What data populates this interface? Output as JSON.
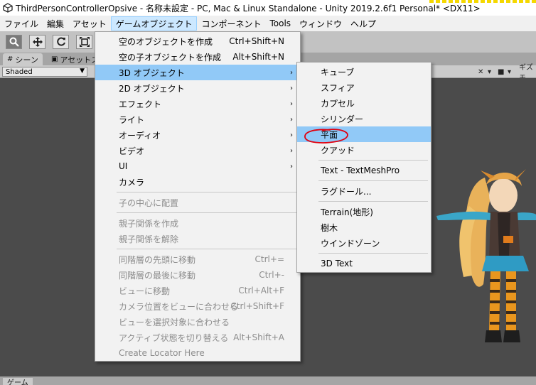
{
  "window": {
    "title": "ThirdPersonControllerOpsive - 名称未設定 - PC, Mac & Linux Standalone - Unity 2019.2.6f1 Personal* <DX11>"
  },
  "menubar": {
    "items": [
      "ファイル",
      "編集",
      "アセット",
      "ゲームオブジェクト",
      "コンポーネント",
      "Tools",
      "ウィンドウ",
      "ヘルプ"
    ]
  },
  "toolbar": {
    "tools": [
      "view-tool",
      "move-tool",
      "rotate-tool",
      "scale-tool"
    ]
  },
  "tabs": {
    "scene": "シーン",
    "asset_store": "アセットスト",
    "game": "ゲーム"
  },
  "scene_toolbar": {
    "shading_mode": "Shaded",
    "gizmos_label": "ギズモ"
  },
  "gameobject_menu": {
    "items": [
      {
        "label": "空のオブジェクトを作成",
        "shortcut": "Ctrl+Shift+N"
      },
      {
        "label": "空の子オブジェクトを作成",
        "shortcut": "Alt+Shift+N"
      },
      {
        "label": "3D オブジェクト",
        "submenu": true
      },
      {
        "label": "2D オブジェクト",
        "submenu": true
      },
      {
        "label": "エフェクト",
        "submenu": true
      },
      {
        "label": "ライト",
        "submenu": true
      },
      {
        "label": "オーディオ",
        "submenu": true
      },
      {
        "label": "ビデオ",
        "submenu": true
      },
      {
        "label": "UI",
        "submenu": true
      },
      {
        "label": "カメラ"
      },
      {
        "label": "子の中心に配置"
      },
      {
        "label": "親子関係を作成"
      },
      {
        "label": "親子関係を解除"
      },
      {
        "label": "同階層の先頭に移動",
        "shortcut": "Ctrl+="
      },
      {
        "label": "同階層の最後に移動",
        "shortcut": "Ctrl+-"
      },
      {
        "label": "ビューに移動",
        "shortcut": "Ctrl+Alt+F"
      },
      {
        "label": "カメラ位置をビューに合わせる",
        "shortcut": "Ctrl+Shift+F"
      },
      {
        "label": "ビューを選択対象に合わせる"
      },
      {
        "label": "アクティブ状態を切り替える",
        "shortcut": "Alt+Shift+A"
      },
      {
        "label": "Create Locator Here"
      }
    ]
  },
  "submenu_3d": {
    "items": [
      {
        "label": "キューブ"
      },
      {
        "label": "スフィア"
      },
      {
        "label": "カプセル"
      },
      {
        "label": "シリンダー"
      },
      {
        "label": "平面"
      },
      {
        "label": "クアッド"
      },
      {
        "label": "Text - TextMeshPro"
      },
      {
        "label": "ラグドール..."
      },
      {
        "label": "Terrain(地形)"
      },
      {
        "label": "樹木"
      },
      {
        "label": "ウインドゾーン"
      },
      {
        "label": "3D Text"
      }
    ]
  },
  "colors": {
    "menu_highlight": "#91c9f7",
    "annotation_red": "#e0000f"
  }
}
